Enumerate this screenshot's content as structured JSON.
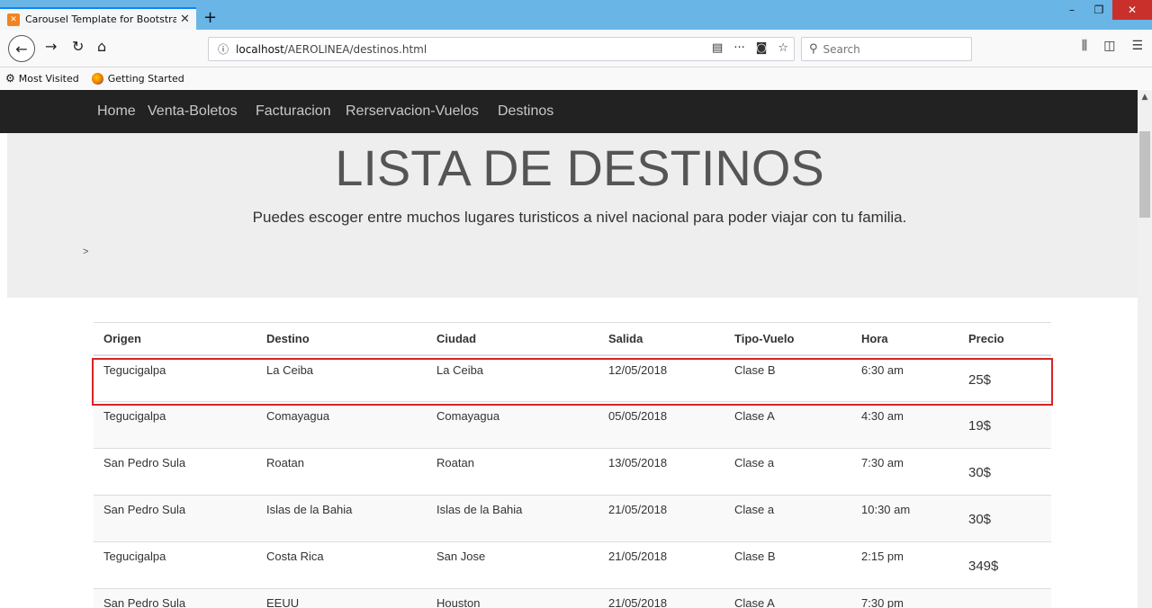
{
  "browser": {
    "tab_title": "Carousel Template for Bootstra",
    "tab_close": "✕",
    "new_tab": "+",
    "url_host": "localhost",
    "url_path": "/AEROLINEA/destinos.html",
    "search_placeholder": "Search",
    "bookmarks": [
      "Most Visited",
      "Getting Started"
    ]
  },
  "site": {
    "nav": [
      "Home",
      "Venta-Boletos",
      "Facturacion",
      "Rerservacion-Vuelos",
      "Destinos"
    ],
    "title": "LISTA DE DESTINOS",
    "subtitle": "Puedes escoger entre muchos lugares turisticos a nivel nacional para poder viajar con tu familia.",
    "stray": ">"
  },
  "table": {
    "headers": [
      "Origen",
      "Destino",
      "Ciudad",
      "Salida",
      "Tipo-Vuelo",
      "Hora",
      "Precio"
    ],
    "rows": [
      [
        "Tegucigalpa",
        "La Ceiba",
        "La Ceiba",
        "12/05/2018",
        "Clase B",
        "6:30 am",
        "25$"
      ],
      [
        "Tegucigalpa",
        "Comayagua",
        "Comayagua",
        "05/05/2018",
        "Clase A",
        "4:30 am",
        "19$"
      ],
      [
        "San Pedro Sula",
        "Roatan",
        "Roatan",
        "13/05/2018",
        "Clase a",
        "7:30 am",
        "30$"
      ],
      [
        "San Pedro Sula",
        "Islas de la Bahia",
        "Islas de la Bahia",
        "21/05/2018",
        "Clase a",
        "10:30 am",
        "30$"
      ],
      [
        "Tegucigalpa",
        "Costa Rica",
        "San Jose",
        "21/05/2018",
        "Clase B",
        "2:15 pm",
        "349$"
      ],
      [
        "San Pedro Sula",
        "EEUU",
        "Houston",
        "21/05/2018",
        "Clase A",
        "7:30 pm",
        ""
      ]
    ]
  },
  "colors": {
    "highlight": "#d62525",
    "site_nav_bg": "#222222",
    "jumbotron_bg": "#eeeeee"
  }
}
